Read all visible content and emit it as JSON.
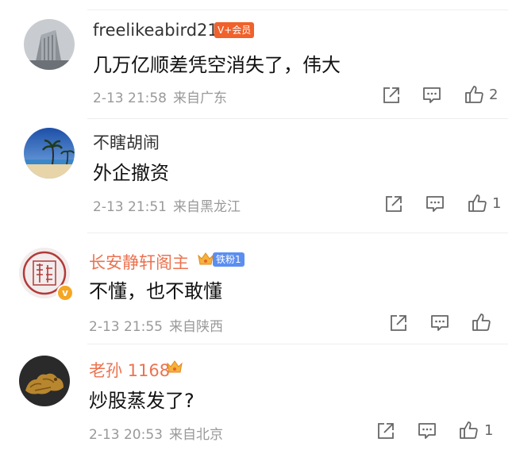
{
  "comments": [
    {
      "username": "freelikeabird21",
      "member_badge": "V+会员",
      "text": "几万亿顺差凭空消失了，伟大",
      "date": "2-13 21:58",
      "location": "来自广东",
      "likes": "2"
    },
    {
      "username": "不瞎胡闹",
      "text": "外企撤资",
      "date": "2-13 21:51",
      "location": "来自黑龙江",
      "likes": "1"
    },
    {
      "username": "长安静轩阁主",
      "fan_badge": "铁粉1",
      "text": "不懂，也不敢懂",
      "date": "2-13 21:55",
      "location": "来自陕西",
      "likes": ""
    },
    {
      "username": "老孙 1168",
      "text": "炒股蒸发了?",
      "date": "2-13 20:53",
      "location": "来自北京",
      "likes": "1"
    }
  ],
  "colors": {
    "username_orange": "#eb7350",
    "member_badge": "#f0612b",
    "fan_badge": "#5b8ef0",
    "meta_gray": "#999999"
  },
  "icons": [
    "share-icon",
    "comment-icon",
    "like-icon",
    "crown-icon",
    "verified-v-icon"
  ]
}
